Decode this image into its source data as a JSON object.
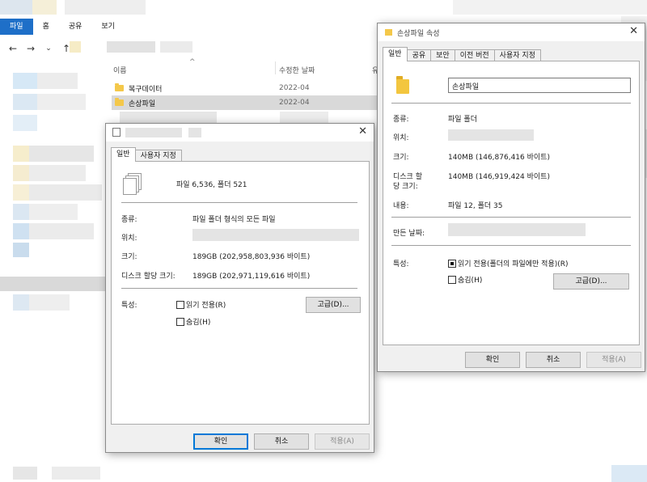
{
  "explorer": {
    "ribbon_tabs": [
      "파일",
      "홈",
      "공유",
      "보기"
    ],
    "nav": {
      "back": "←",
      "forward": "→",
      "recent": "⌄",
      "up": "↑"
    },
    "columns": {
      "name": "이름",
      "modified": "수정한 날짜",
      "type_abbr": "유"
    },
    "sort_indicator": "^",
    "files": [
      {
        "name": "복구데이터",
        "date": "2022-04"
      },
      {
        "name": "손상파일",
        "date": "2022-04"
      }
    ]
  },
  "dialog_multi": {
    "close": "✕",
    "tabs": [
      "일반",
      "사용자 지정"
    ],
    "summary": "파일 6,536, 폴더 521",
    "type_label": "종류:",
    "type_value": "파일 폴더 형식의 모든 파일",
    "location_label": "위치:",
    "size_label": "크기:",
    "size_value": "189GB (202,958,803,936 바이트)",
    "disk_label": "디스크 할당 크기:",
    "disk_value": "189GB (202,971,119,616 바이트)",
    "attr_label": "특성:",
    "readonly": "읽기 전용(R)",
    "hidden": "숨김(H)",
    "advanced": "고급(D)...",
    "ok": "확인",
    "cancel": "취소",
    "apply": "적용(A)"
  },
  "dialog_folder": {
    "title": "손상파일 속성",
    "close": "✕",
    "tabs": [
      "일반",
      "공유",
      "보안",
      "이전 버전",
      "사용자 지정"
    ],
    "folder_name": "손상파일",
    "type_label": "종류:",
    "type_value": "파일 폴더",
    "location_label": "위치:",
    "size_label": "크기:",
    "size_value": "140MB (146,876,416 바이트)",
    "disk_label_1": "디스크 할",
    "disk_label_2": "당 크기:",
    "disk_value": "140MB (146,919,424 바이트)",
    "contents_label": "내용:",
    "contents_value": "파일 12, 폴더 35",
    "created_label": "만든 날짜:",
    "attr_label": "특성:",
    "readonly": "읽기 전용(폴더의 파일에만 적용)(R)",
    "hidden": "숨김(H)",
    "advanced": "고급(D)...",
    "ok": "확인",
    "cancel": "취소",
    "apply": "적용(A)"
  },
  "colors": {
    "accent": "#1e6fc8",
    "folder": "#f4c84a",
    "dialog_bg": "#f0f0f0"
  }
}
